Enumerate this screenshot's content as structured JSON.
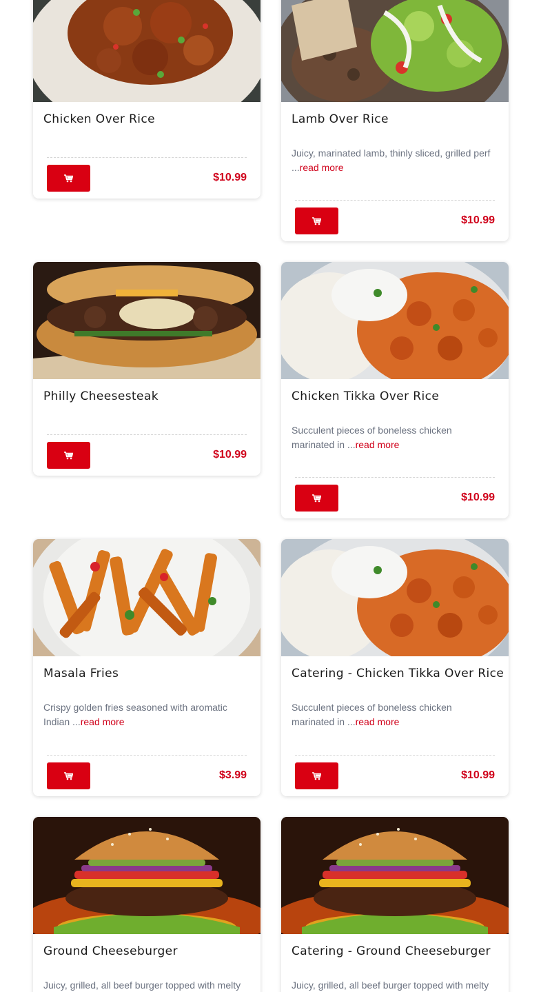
{
  "colors": {
    "accent": "#d90012",
    "price": "#d0021b",
    "description": "#6b7280"
  },
  "cart_icon": "shopping-cart-icon",
  "read_more_label": "read more",
  "items": [
    {
      "title": "Chicken Over Rice",
      "desc": "",
      "price": "$10.99",
      "image": "chicken-rice"
    },
    {
      "title": "Lamb Over Rice",
      "desc": "Juicy, marinated lamb, thinly sliced, grilled perf ...",
      "price": "$10.99",
      "image": "lamb-rice"
    },
    {
      "title": "Philly Cheesesteak",
      "desc": "",
      "price": "$10.99",
      "image": "cheesesteak"
    },
    {
      "title": "Chicken Tikka Over Rice",
      "desc": "Succulent pieces of boneless chicken marinated in ...",
      "price": "$10.99",
      "image": "tikka"
    },
    {
      "title": "Masala Fries",
      "desc": "Crispy golden fries seasoned with aromatic Indian ...",
      "price": "$3.99",
      "image": "fries"
    },
    {
      "title": "Catering - Chicken Tikka Over Rice",
      "desc": "Succulent pieces of boneless chicken marinated in ...",
      "price": "$10.99",
      "image": "tikka"
    },
    {
      "title": "Ground Cheeseburger",
      "desc": "Juicy, grilled, all beef burger topped with melty",
      "price": "",
      "image": "burger"
    },
    {
      "title": "Catering - Ground Cheeseburger",
      "desc": "Juicy, grilled, all beef burger topped with melty",
      "price": "",
      "image": "burger"
    }
  ]
}
